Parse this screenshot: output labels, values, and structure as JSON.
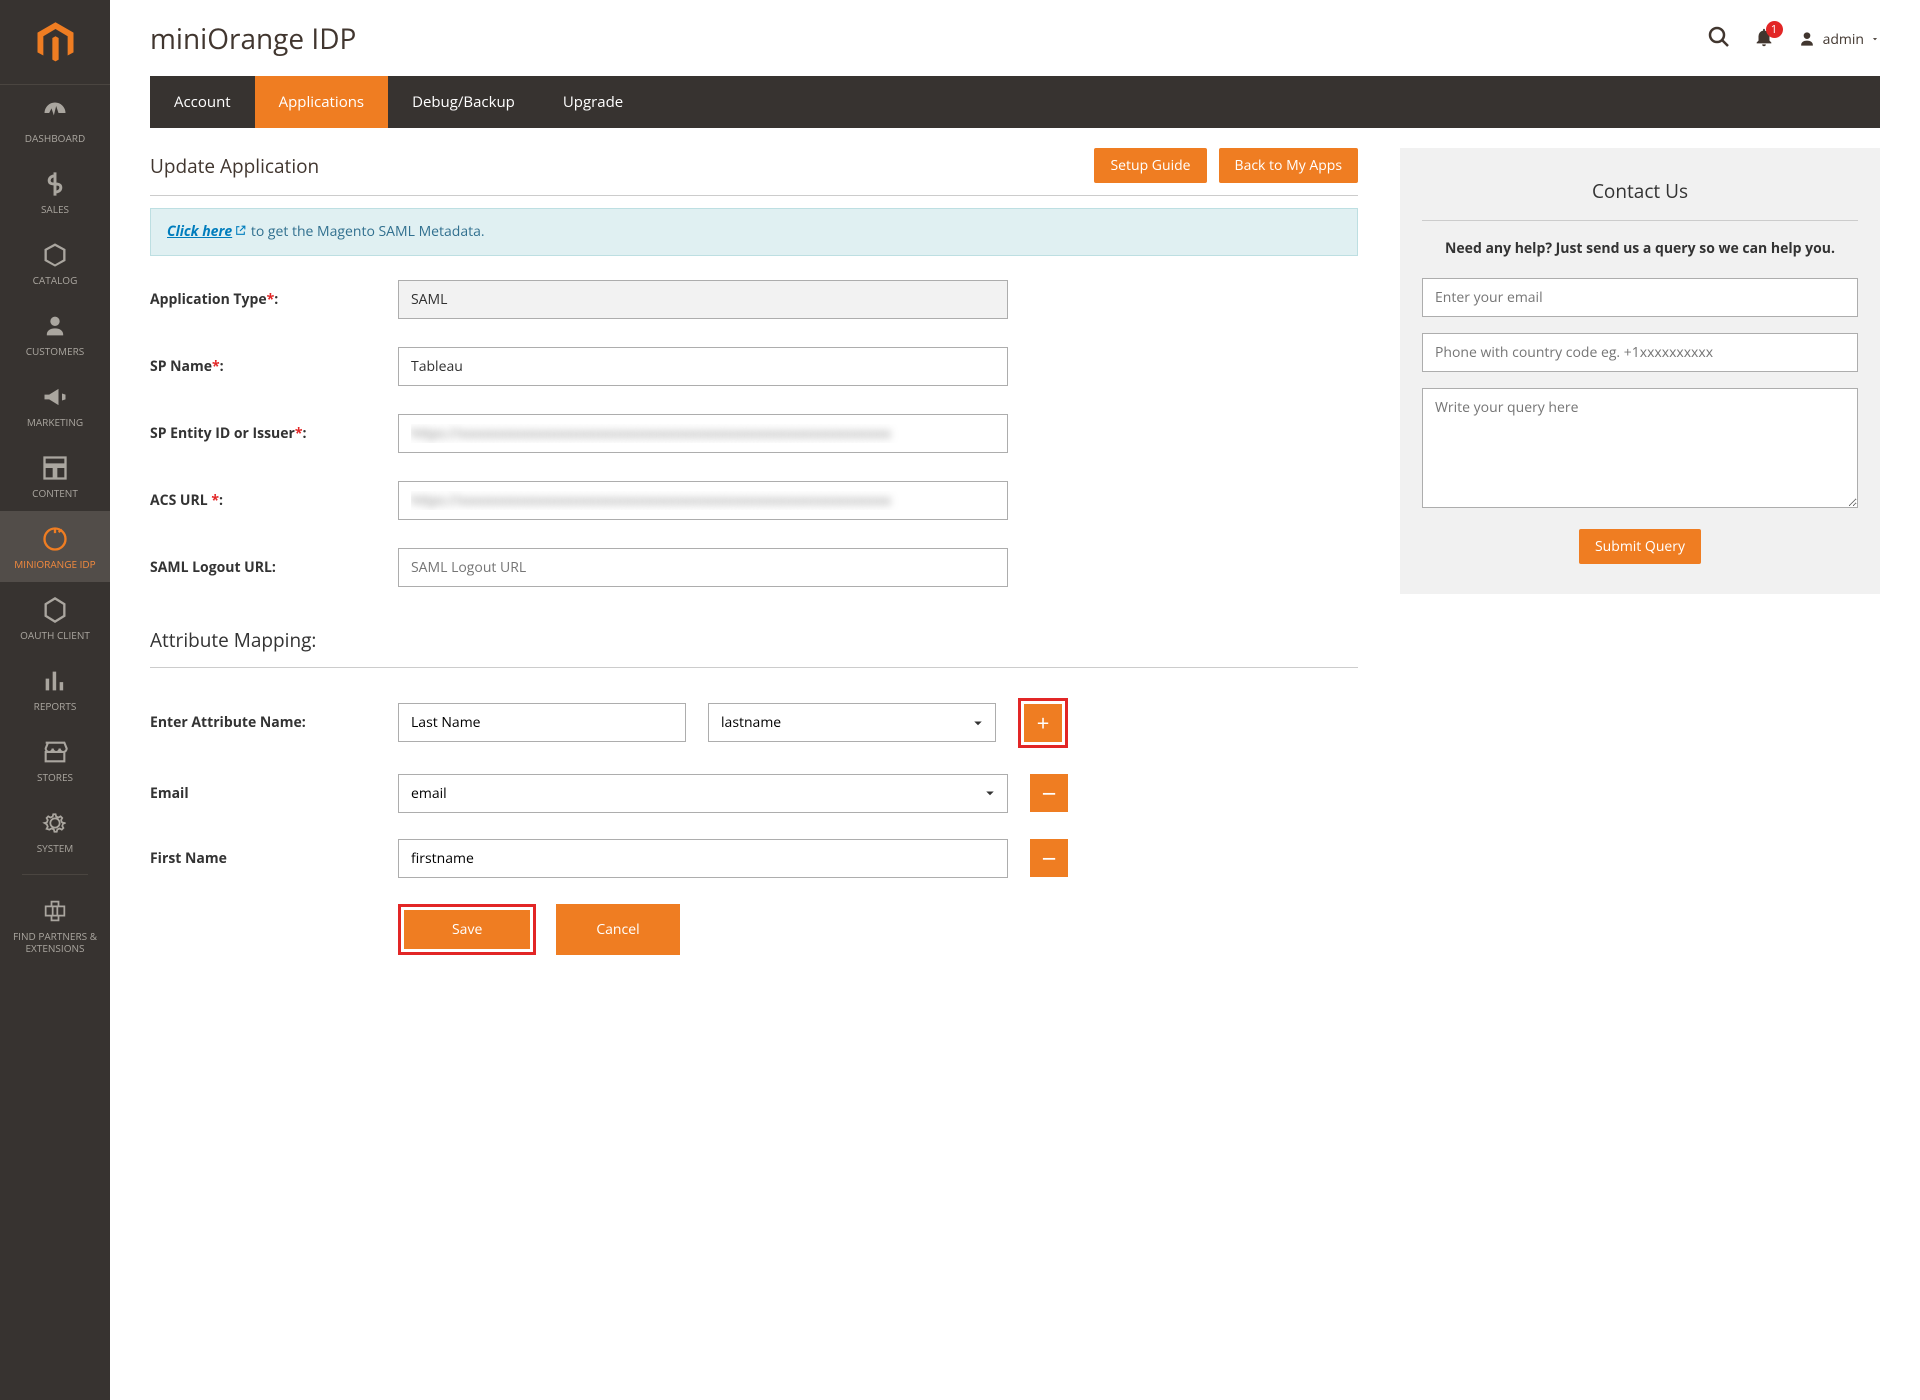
{
  "header": {
    "title": "miniOrange IDP",
    "notif_count": "1",
    "user_label": "admin"
  },
  "sidebar": {
    "items": [
      {
        "label": "DASHBOARD",
        "icon": "dashboard"
      },
      {
        "label": "SALES",
        "icon": "dollar"
      },
      {
        "label": "CATALOG",
        "icon": "cube"
      },
      {
        "label": "CUSTOMERS",
        "icon": "person"
      },
      {
        "label": "MARKETING",
        "icon": "megaphone"
      },
      {
        "label": "CONTENT",
        "icon": "layout"
      },
      {
        "label": "miniOrange IDP",
        "icon": "mo-idp",
        "active": true
      },
      {
        "label": "OAUTH CLIENT",
        "icon": "hexagon"
      },
      {
        "label": "REPORTS",
        "icon": "bars"
      },
      {
        "label": "STORES",
        "icon": "store"
      },
      {
        "label": "SYSTEM",
        "icon": "gear"
      },
      {
        "label": "FIND PARTNERS & EXTENSIONS",
        "icon": "partners"
      }
    ]
  },
  "tabs": [
    {
      "label": "Account"
    },
    {
      "label": "Applications",
      "active": true
    },
    {
      "label": "Debug/Backup"
    },
    {
      "label": "Upgrade"
    }
  ],
  "section": {
    "title": "Update Application",
    "setup_guide": "Setup Guide",
    "back_btn": "Back to My Apps",
    "info_link": "Click here",
    "info_rest": " to get the Magento SAML Metadata."
  },
  "form": {
    "app_type_label": "Application Type",
    "app_type_value": "SAML",
    "sp_name_label": "SP Name",
    "sp_name_value": "Tableau",
    "entity_label": "SP Entity ID or Issuer",
    "entity_value": "https://xxxxxxxxxxxxxxxxxxxxxxxxxxxxxxxxxxxxxxxxxxxxxxxxxxxxxxxxxxx",
    "acs_label": "ACS URL ",
    "acs_value": "https://xxxxxxxxxxxxxxxxxxxxxxxxxxxxxxxxxxxxxxxxxxxxxxxxxxxxxxxxxxx",
    "logout_label": "SAML Logout URL:",
    "logout_placeholder": "SAML Logout URL"
  },
  "attr": {
    "title": "Attribute Mapping:",
    "enter_label": "Enter Attribute Name:",
    "name_value": "Last Name",
    "select_value": "lastname",
    "rows": [
      {
        "label": "Email",
        "value": "email",
        "type": "select"
      },
      {
        "label": "First Name",
        "value": "firstname",
        "type": "input"
      }
    ],
    "save": "Save",
    "cancel": "Cancel"
  },
  "contact": {
    "title": "Contact Us",
    "help": "Need any help? Just send us a query so we can help you.",
    "email_placeholder": "Enter your email",
    "phone_placeholder": "Phone with country code eg. +1xxxxxxxxxx",
    "query_placeholder": "Write your query here",
    "submit": "Submit Query"
  }
}
